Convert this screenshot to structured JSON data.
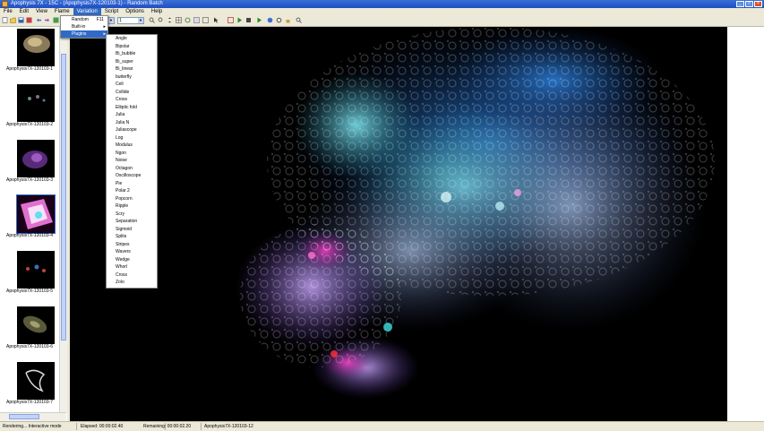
{
  "window": {
    "title": "Apophysis 7X - 15C - (Apophysis7X-120103-1) - Random Batch",
    "buttons": [
      "_",
      "□",
      "×"
    ]
  },
  "menubar": {
    "items": [
      {
        "label": "File",
        "active": false
      },
      {
        "label": "Edit",
        "active": false
      },
      {
        "label": "View",
        "active": false
      },
      {
        "label": "Flame",
        "active": false
      },
      {
        "label": "Variation",
        "active": true
      },
      {
        "label": "Script",
        "active": false
      },
      {
        "label": "Options",
        "active": false
      },
      {
        "label": "Help",
        "active": false
      }
    ]
  },
  "toolbar": {
    "combo1_value": "1",
    "combo2_value": "1"
  },
  "variation_menu": {
    "items": [
      {
        "label": "Random",
        "hotkey": "F11",
        "highlighted": false,
        "submenu": false
      },
      {
        "label": "Built-in",
        "hotkey": "",
        "highlighted": false,
        "submenu": true
      },
      {
        "label": "Plugins",
        "hotkey": "",
        "highlighted": true,
        "submenu": true
      }
    ]
  },
  "plugins_submenu": {
    "items": [
      "Angle",
      "Bipolar",
      "Bi_bubble",
      "Bi_super",
      "Bi_linear",
      "butterfly",
      "Cell",
      "Collide",
      "Cross",
      "Elliptic fold",
      "Julia",
      "Julia N",
      "Juliascope",
      "Log",
      "Modulus",
      "Ngon",
      "Noise",
      "Octagon",
      "Oscilloscope",
      "Pie",
      "Polar 2",
      "Popcorn",
      "Ripple",
      "Scry",
      "Separation",
      "Sigmoid",
      "Splits",
      "Stripes",
      "Wavers",
      "Wedge",
      "Whorl",
      "Cross",
      "Zolo"
    ]
  },
  "thumbnails": [
    {
      "label": "Apophysis7X-120103-1",
      "kind": "gold"
    },
    {
      "label": "Apophysis7X-120103-2",
      "kind": "sparse"
    },
    {
      "label": "Apophysis7X-120103-3",
      "kind": "purple"
    },
    {
      "label": "Apophysis7X-120103-4",
      "kind": "pink"
    },
    {
      "label": "Apophysis7X-120103-5",
      "kind": "dots"
    },
    {
      "label": "Apophysis7X-120103-6",
      "kind": "olive"
    },
    {
      "label": "Apophysis7X-120103-7",
      "kind": "white"
    }
  ],
  "statusbar": {
    "render_text": "Rendering... Interactive mode",
    "elapsed": "Elapsed: 00:00:02.40",
    "remaining": "Remaining: 00:00:02.20",
    "flame_name": "Apophysis7X-120103-12"
  },
  "colors": {
    "accent": "#316ac5",
    "titlebar": "#2a5fd0",
    "chrome": "#ece9d8",
    "canvas": "#000000"
  }
}
